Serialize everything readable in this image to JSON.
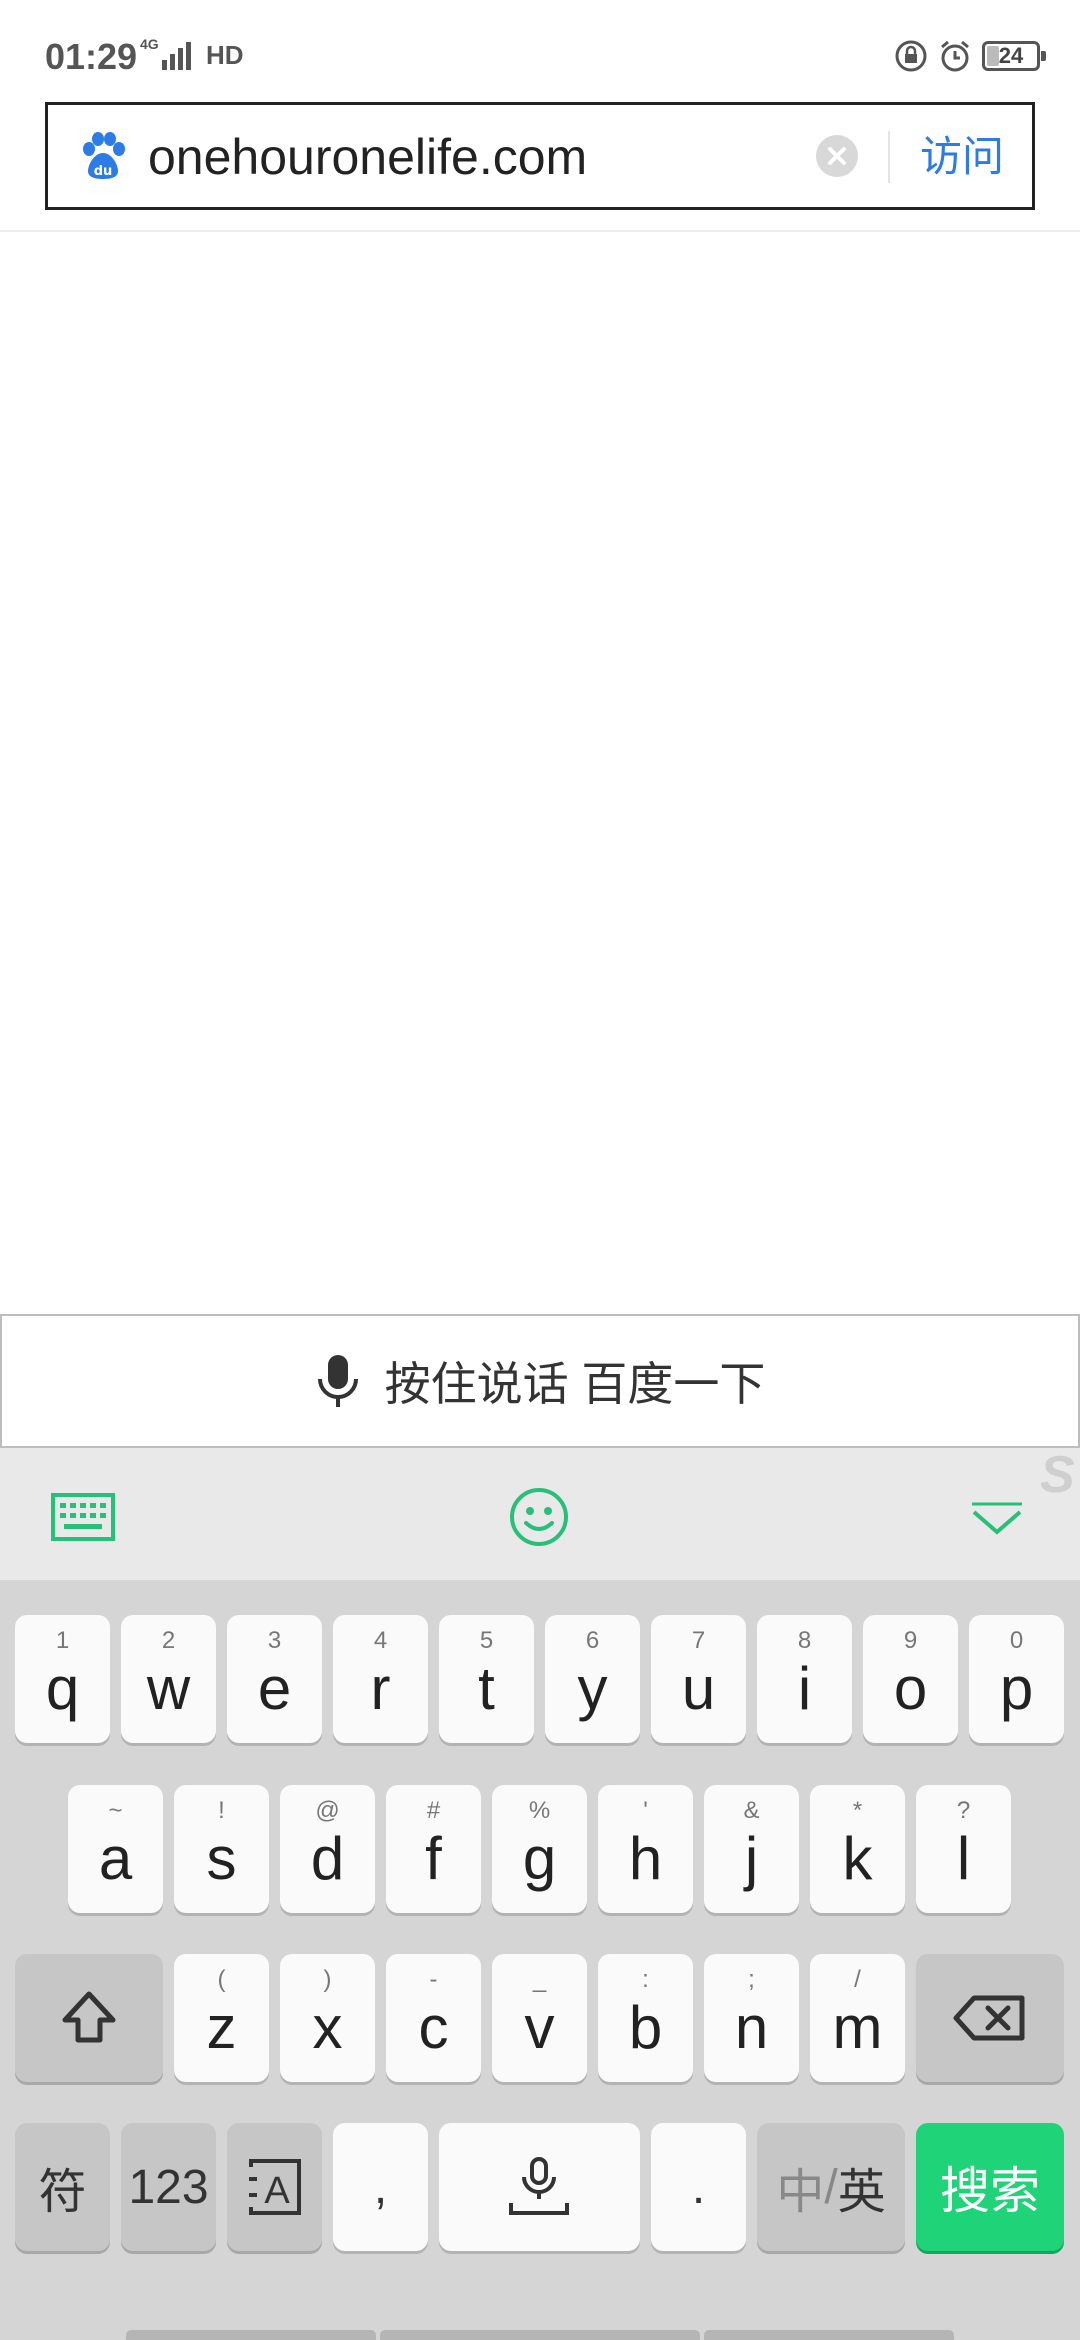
{
  "status_bar": {
    "time": "01:29",
    "network_type": "4G",
    "hd_label": "HD",
    "battery_level": "24"
  },
  "address_bar": {
    "url": "onehouronelife.com",
    "visit_label": "访问",
    "accent_color": "#2d7be5"
  },
  "voice_bar": {
    "label": "按住说话 百度一下"
  },
  "keyboard": {
    "toolbar_icons": [
      "keyboard-icon",
      "emoji-icon",
      "collapse-icon",
      "sogou-logo"
    ],
    "row1": [
      {
        "hint": "1",
        "key": "q"
      },
      {
        "hint": "2",
        "key": "w"
      },
      {
        "hint": "3",
        "key": "e"
      },
      {
        "hint": "4",
        "key": "r"
      },
      {
        "hint": "5",
        "key": "t"
      },
      {
        "hint": "6",
        "key": "y"
      },
      {
        "hint": "7",
        "key": "u"
      },
      {
        "hint": "8",
        "key": "i"
      },
      {
        "hint": "9",
        "key": "o"
      },
      {
        "hint": "0",
        "key": "p"
      }
    ],
    "row2": [
      {
        "hint": "~",
        "key": "a"
      },
      {
        "hint": "!",
        "key": "s"
      },
      {
        "hint": "@",
        "key": "d"
      },
      {
        "hint": "#",
        "key": "f"
      },
      {
        "hint": "%",
        "key": "g"
      },
      {
        "hint": "'",
        "key": "h"
      },
      {
        "hint": "&",
        "key": "j"
      },
      {
        "hint": "*",
        "key": "k"
      },
      {
        "hint": "?",
        "key": "l"
      }
    ],
    "row3": [
      {
        "hint": "(",
        "key": "z"
      },
      {
        "hint": ")",
        "key": "x"
      },
      {
        "hint": "-",
        "key": "c"
      },
      {
        "hint": "_",
        "key": "v"
      },
      {
        "hint": ":",
        "key": "b"
      },
      {
        "hint": ";",
        "key": "n"
      },
      {
        "hint": "/",
        "key": "m"
      }
    ],
    "symbols_label": "符",
    "numbers_label": "123",
    "comma_label": ",",
    "period_label": ".",
    "lang_toggle": {
      "zh": "中",
      "sep": "/",
      "en": "英"
    },
    "search_label": "搜索",
    "accent_color": "#1fd379"
  }
}
